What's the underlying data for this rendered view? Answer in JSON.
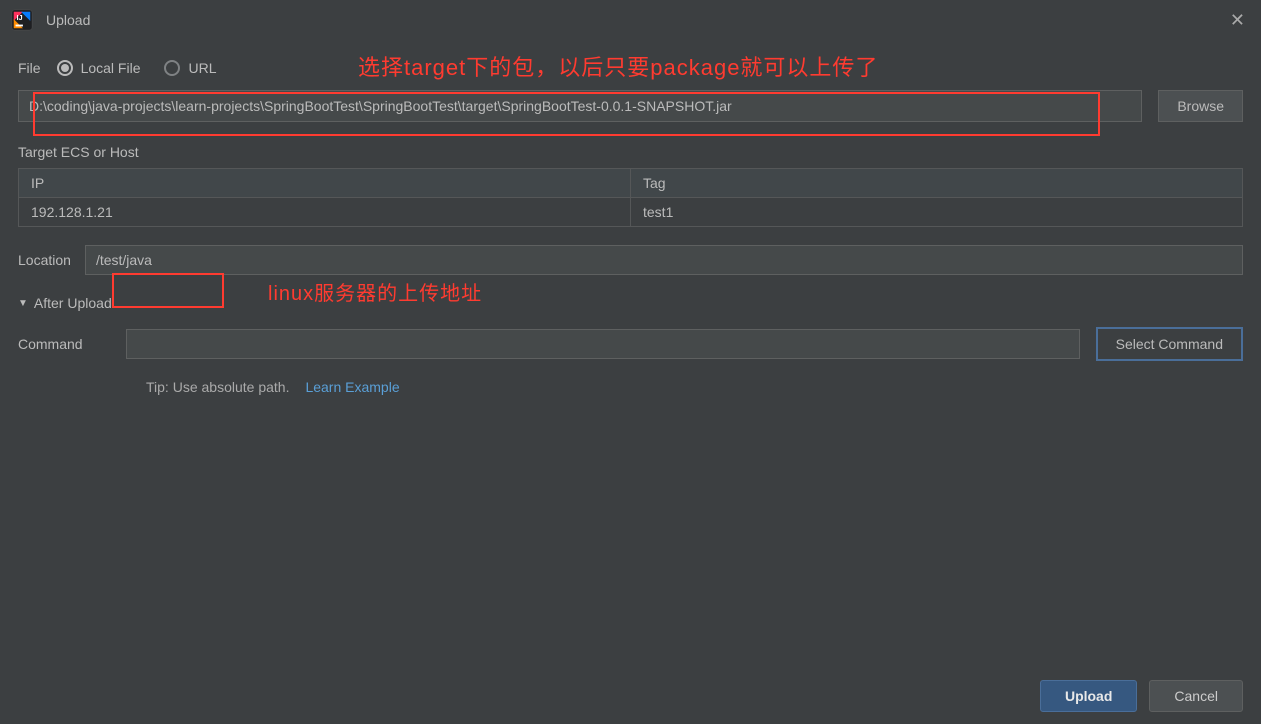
{
  "dialog": {
    "title": "Upload",
    "annotations": {
      "top": "选择target下的包，以后只要package就可以上传了",
      "location": "linux服务器的上传地址"
    }
  },
  "file": {
    "label": "File",
    "options": {
      "local": "Local File",
      "url": "URL"
    },
    "selected": "local",
    "path": "D:\\coding\\java-projects\\learn-projects\\SpringBootTest\\SpringBootTest\\target\\SpringBootTest-0.0.1-SNAPSHOT.jar",
    "browse_label": "Browse"
  },
  "target": {
    "label": "Target ECS or Host",
    "columns": {
      "ip": "IP",
      "tag": "Tag"
    },
    "rows": [
      {
        "ip": "192.128.1.21",
        "tag": "test1"
      }
    ]
  },
  "location": {
    "label": "Location",
    "value": "/test/java"
  },
  "after_upload": {
    "label": "After Upload",
    "command_label": "Command",
    "command_value": "",
    "select_command_label": "Select Command",
    "tip": "Tip: Use absolute path.",
    "learn_link": "Learn Example"
  },
  "footer": {
    "upload": "Upload",
    "cancel": "Cancel"
  }
}
